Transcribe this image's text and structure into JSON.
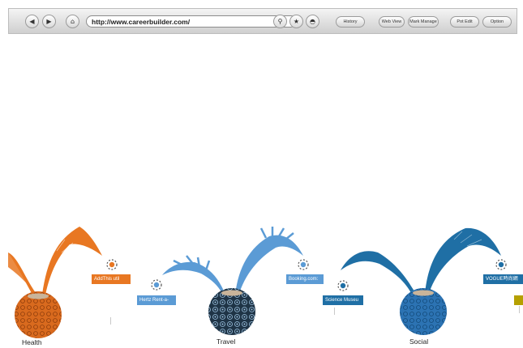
{
  "browser": {
    "url": "http://www.careerbuilder.com/",
    "buttons": {
      "history": "History",
      "web_view": "Web View",
      "mark_manage": "Mark Manage",
      "pot_edit": "Pot Edit",
      "option": "Option"
    },
    "icons": [
      "back-arrow-icon",
      "forward-arrow-icon",
      "home-icon",
      "search-icon",
      "star-icon",
      "pot-icon"
    ]
  },
  "pots": [
    {
      "category": "Health",
      "color": "#e87722",
      "bookmarks": [
        "AddThis util"
      ]
    },
    {
      "category": "Travel",
      "color": "#5b9bd5",
      "bookmarks": [
        "Hertz Rent-a-",
        "Booking.com:"
      ]
    },
    {
      "category": "Social",
      "color": "#1f6fa5",
      "bookmarks": [
        "Science Museu",
        "VOGUE時尚網"
      ]
    }
  ],
  "colors": {
    "health": "#e87722",
    "travel": "#5b9bd5",
    "social": "#1f6fa5",
    "extra_tag": "#b5a000"
  }
}
